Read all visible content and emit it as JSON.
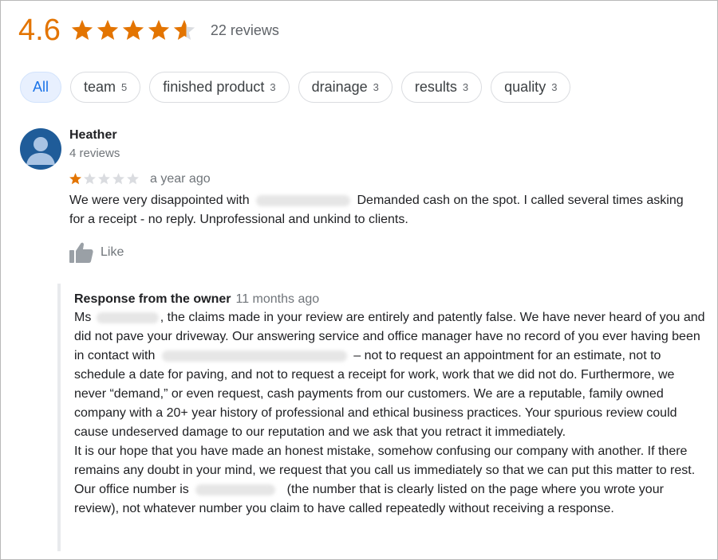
{
  "rating": {
    "value": "4.6",
    "stars": 4.6,
    "count_label": "22 reviews",
    "star_color": "#e37400"
  },
  "chips": [
    {
      "label": "All",
      "count": ""
    },
    {
      "label": "team",
      "count": "5"
    },
    {
      "label": "finished product",
      "count": "3"
    },
    {
      "label": "drainage",
      "count": "3"
    },
    {
      "label": "results",
      "count": "3"
    },
    {
      "label": "quality",
      "count": "3"
    }
  ],
  "review": {
    "author": "Heather",
    "author_sub": "4 reviews",
    "stars": 1,
    "time": "a year ago",
    "text_1": "We were very disappointed with",
    "text_2": "Demanded cash on the spot.  I called several times asking for a receipt - no reply.  Unprofessional and unkind to clients.",
    "like_label": "Like",
    "avatar_icon": "person-icon"
  },
  "owner_response": {
    "title": "Response from the owner",
    "time": "11 months ago",
    "p1_a": "Ms",
    "p1_b": ", the claims made in your review are entirely and patently false. We have never heard of you and did not pave your driveway. Our answering service and office manager have no record of you ever having been in contact with",
    "p1_c": "– not to request an appointment for an estimate, not to schedule a date for paving, and not to request a receipt for work, work that we did not do. Furthermore, we never “demand,” or even request, cash payments from our customers. We are a reputable, family owned company with a 20+ year history of professional and ethical business practices. Your spurious review could cause undeserved damage to our reputation and we ask that you retract it immediately.",
    "p2_a": "It is our hope that you have made an honest mistake, somehow confusing our company with another. If there remains any doubt in your mind, we request that you call us immediately so that we can put this matter to rest. Our office number is",
    "p2_b": "(the number that is clearly listed on the page where you wrote your review), not whatever number you claim to have called repeatedly without receiving a response."
  }
}
